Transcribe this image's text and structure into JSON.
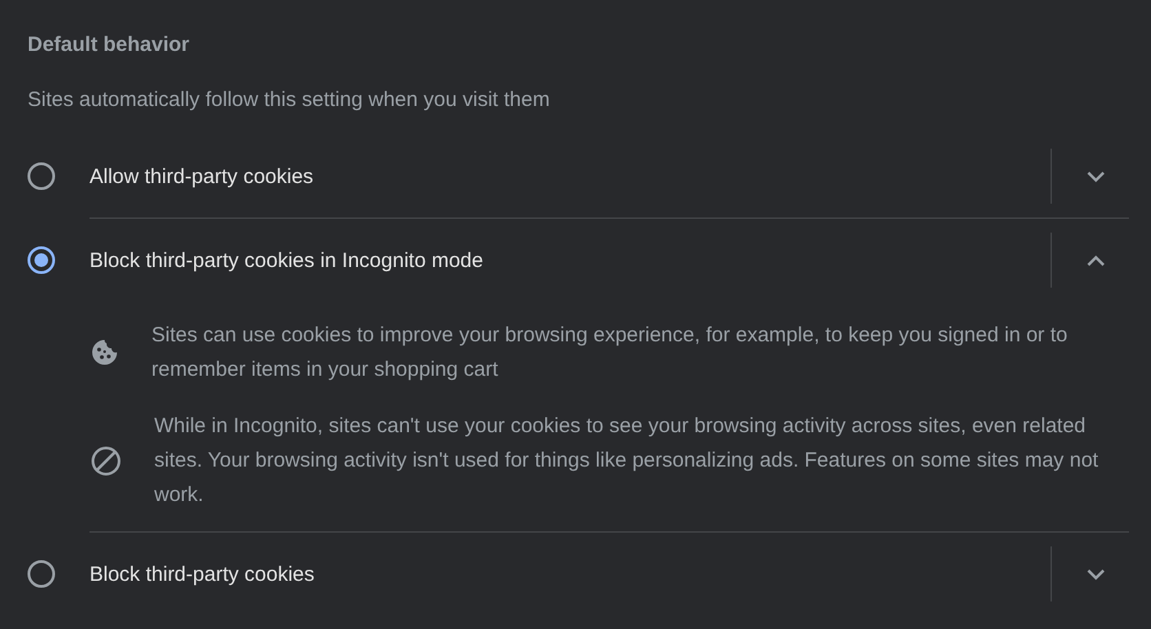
{
  "section": {
    "title": "Default behavior",
    "description": "Sites automatically follow this setting when you visit them"
  },
  "options": [
    {
      "label": "Allow third-party cookies",
      "selected": false,
      "expanded": false
    },
    {
      "label": "Block third-party cookies in Incognito mode",
      "selected": true,
      "expanded": true,
      "details": [
        {
          "kind": "cookie",
          "text": "Sites can use cookies to improve your browsing experience, for example, to keep you signed in or to remember items in your shopping cart"
        },
        {
          "kind": "blocked",
          "text": "While in Incognito, sites can't use your cookies to see your browsing activity across sites, even related sites. Your browsing activity isn't used for things like personalizing ads. Features on some sites may not work."
        }
      ]
    },
    {
      "label": "Block third-party cookies",
      "selected": false,
      "expanded": false
    }
  ]
}
